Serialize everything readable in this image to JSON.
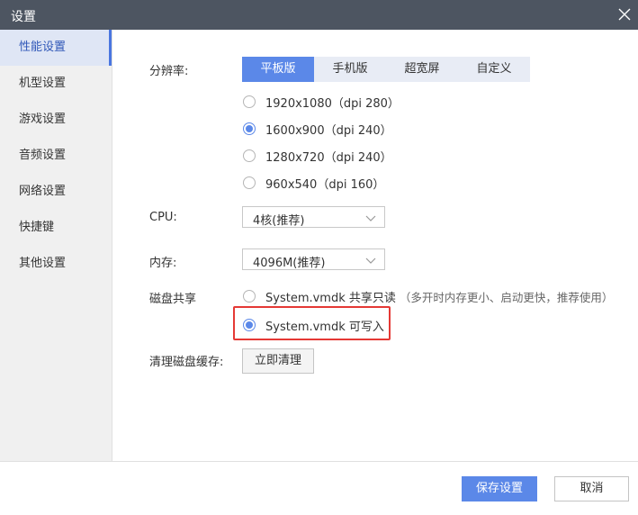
{
  "window": {
    "title": "设置"
  },
  "sidebar": {
    "items": [
      {
        "label": "性能设置",
        "active": true
      },
      {
        "label": "机型设置"
      },
      {
        "label": "游戏设置"
      },
      {
        "label": "音频设置"
      },
      {
        "label": "网络设置"
      },
      {
        "label": "快捷键"
      },
      {
        "label": "其他设置"
      }
    ]
  },
  "resolution": {
    "label": "分辨率:",
    "tabs": [
      "平板版",
      "手机版",
      "超宽屏",
      "自定义"
    ],
    "active_tab": "平板版",
    "options": [
      "1920x1080（dpi 280）",
      "1600x900（dpi 240）",
      "1280x720（dpi 240）",
      "960x540（dpi 160）"
    ],
    "selected": "1600x900（dpi 240）"
  },
  "cpu": {
    "label": "CPU:",
    "value": "4核(推荐)"
  },
  "memory": {
    "label": "内存:",
    "value": "4096M(推荐)"
  },
  "disk_share": {
    "label": "磁盘共享",
    "options": [
      {
        "label": "System.vmdk 共享只读",
        "note": "（多开时内存更小、启动更快，推荐使用）"
      },
      {
        "label": "System.vmdk 可写入",
        "note": ""
      }
    ],
    "selected": "System.vmdk 可写入"
  },
  "clear_cache": {
    "label": "清理磁盘缓存:",
    "button": "立即清理"
  },
  "footer": {
    "save": "保存设置",
    "cancel": "取消"
  },
  "colors": {
    "accent": "#5b88e8",
    "titlebar": "#4d5561",
    "highlight": "#e53935",
    "sidebar_bg": "#f0f0f0"
  },
  "icons": {
    "close": "close-icon",
    "dropdown": "chevron-down-icon"
  }
}
